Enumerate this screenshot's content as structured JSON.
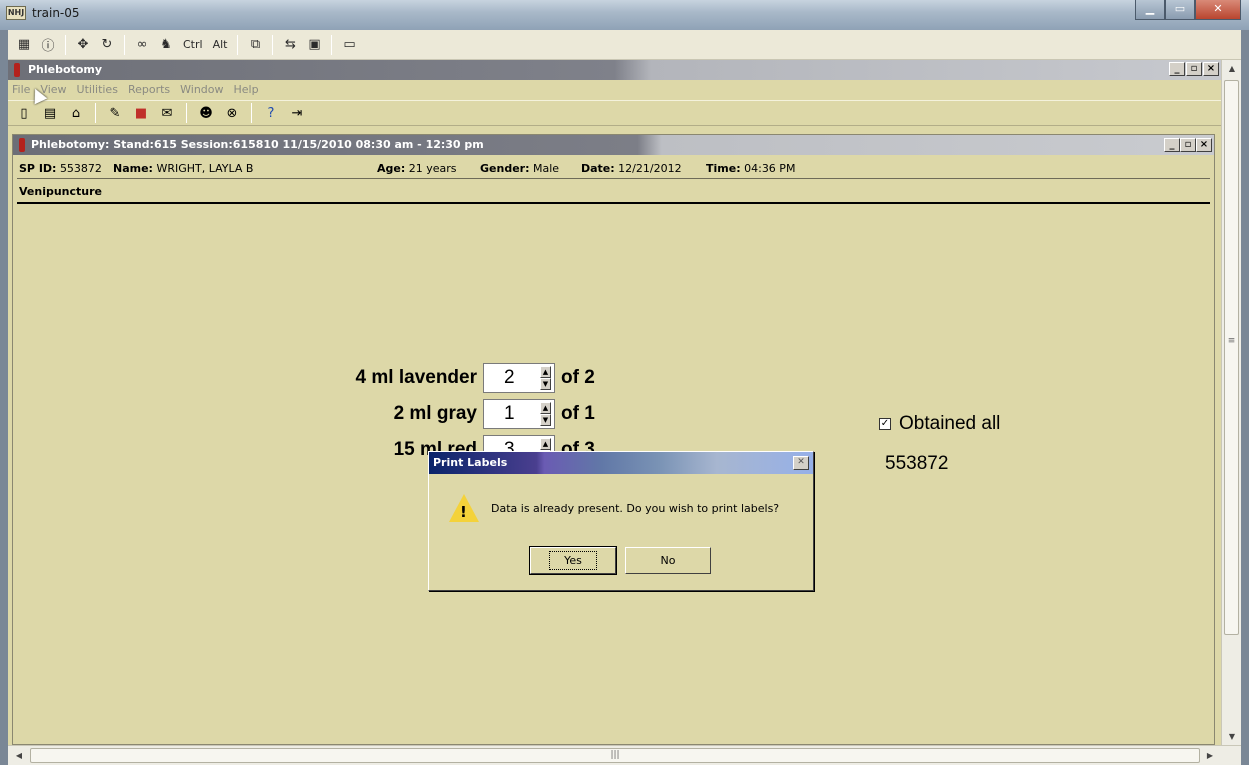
{
  "outer_window": {
    "title": "train-05",
    "icon_label": "NHJ"
  },
  "citrix_toolbar": {
    "ctrl_label": "Ctrl",
    "alt_label": "Alt"
  },
  "app": {
    "title": "Phlebotomy",
    "menu": [
      "File",
      "View",
      "Utilities",
      "Reports",
      "Window",
      "Help"
    ],
    "controls": {
      "minimize": "_",
      "restore": "▫",
      "close": "×"
    }
  },
  "child": {
    "title": "Phlebotomy: Stand:615 Session:615810 11/15/2010 08:30 am - 12:30 pm",
    "sp_id_label": "SP ID:",
    "sp_id": "553872",
    "name_label": "Name:",
    "name": "WRIGHT, LAYLA B",
    "age_label": "Age:",
    "age": "21 years",
    "gender_label": "Gender:",
    "gender": "Male",
    "date_label": "Date:",
    "date": "12/21/2012",
    "time_label": "Time:",
    "time": "04:36 PM",
    "section": "Venipuncture"
  },
  "tubes": [
    {
      "label": "4 ml lavender",
      "value": "2",
      "of": "of 2"
    },
    {
      "label": "2 ml gray",
      "value": "1",
      "of": "of 1"
    },
    {
      "label": "15 ml red",
      "value": "3",
      "of": "of 3"
    }
  ],
  "obtained_all": {
    "label": "Obtained all",
    "checked": true
  },
  "sp_number": "553872",
  "dialog": {
    "title": "Print Labels",
    "message": "Data is already present. Do you wish to print labels?",
    "yes_label": "Yes",
    "no_label": "No"
  },
  "colors": {
    "background": "#ddd8a8",
    "dialog_title": "#0a246a",
    "warning": "#f4d23a"
  }
}
